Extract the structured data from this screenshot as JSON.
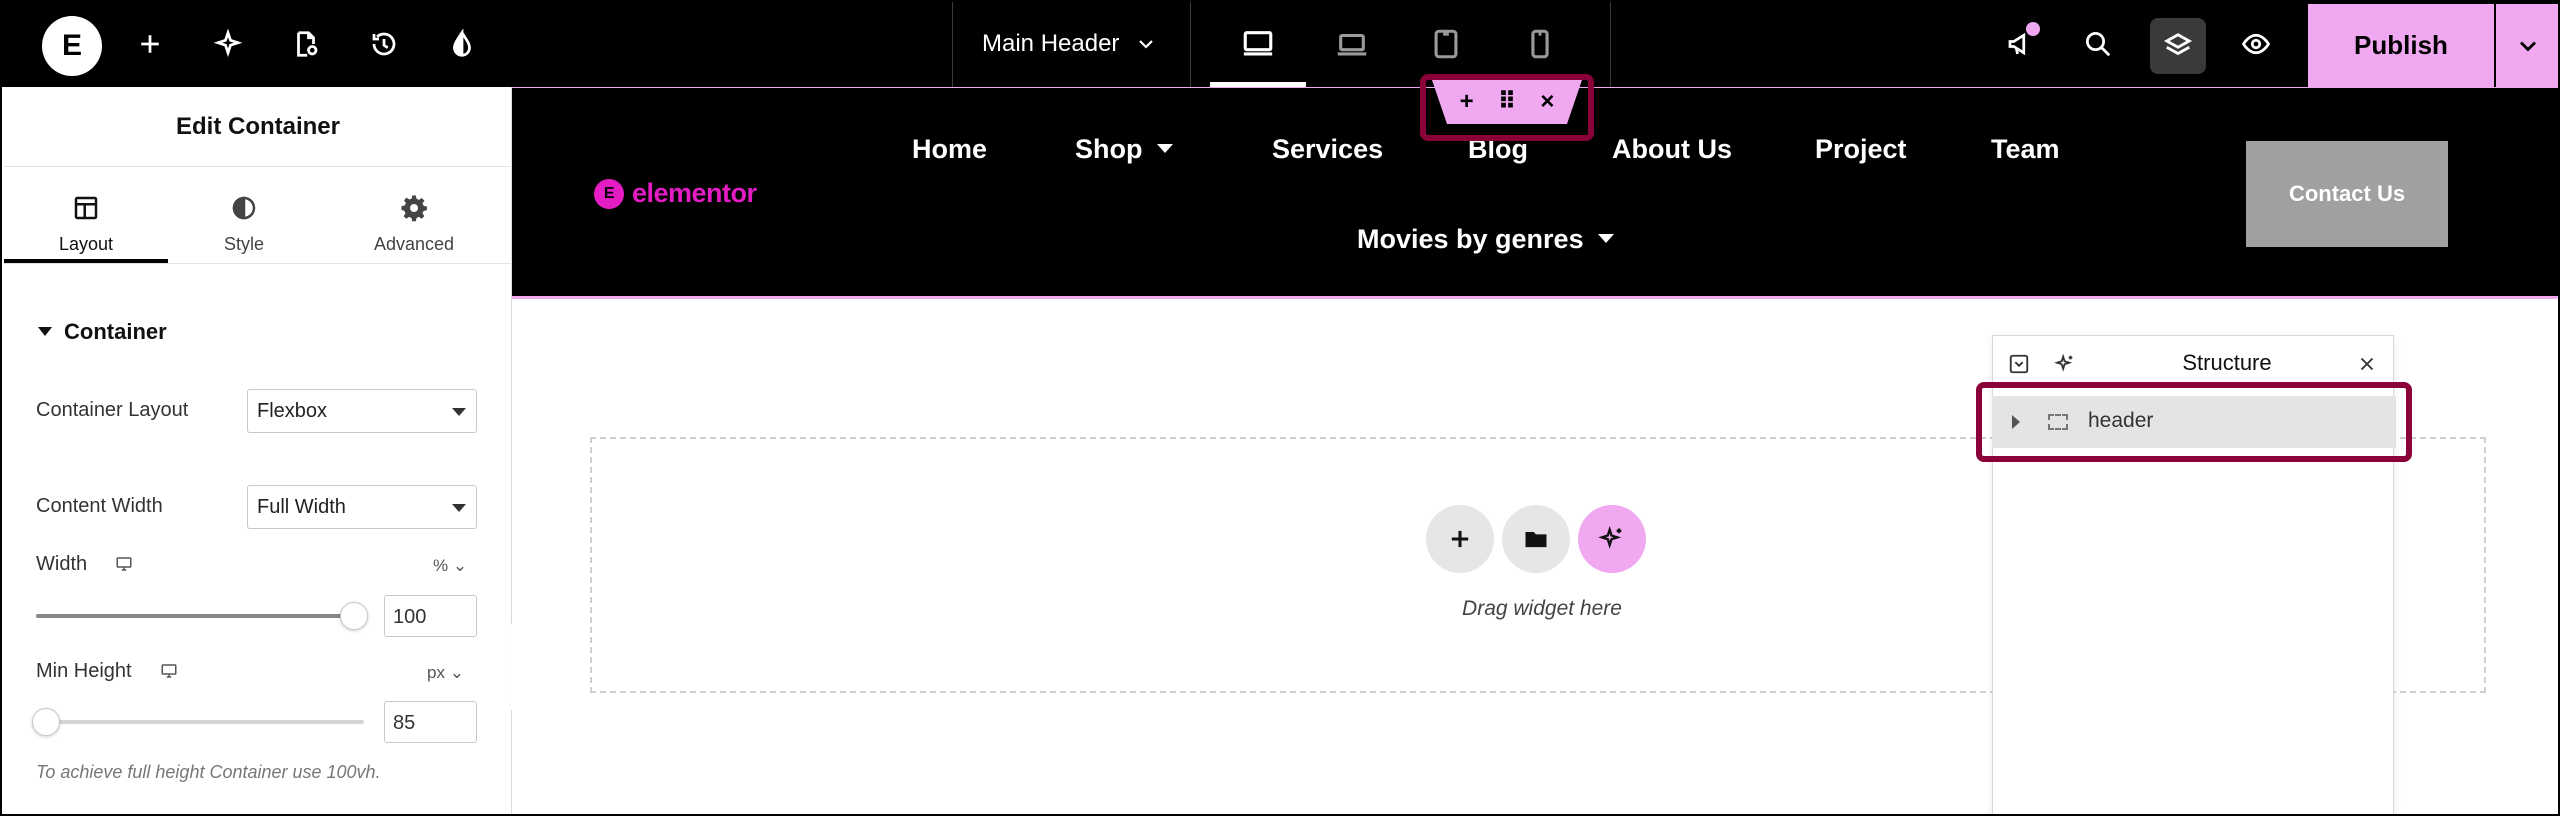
{
  "topbar": {
    "logo": "E",
    "document_title": "Main Header",
    "publish_label": "Publish",
    "colors": {
      "accent": "#f0a8f0",
      "highlight": "#8a0038"
    }
  },
  "panel": {
    "title": "Edit Container",
    "tabs": [
      {
        "label": "Layout",
        "icon": "layout-icon"
      },
      {
        "label": "Style",
        "icon": "style-icon"
      },
      {
        "label": "Advanced",
        "icon": "gear-icon"
      }
    ],
    "section_title": "Container",
    "container_layout": {
      "label": "Container Layout",
      "value": "Flexbox"
    },
    "content_width": {
      "label": "Content Width",
      "value": "Full Width"
    },
    "width": {
      "label": "Width",
      "unit": "%",
      "value": "100",
      "slider_fraction": 1.0
    },
    "min_height": {
      "label": "Min Height",
      "unit": "px",
      "value": "85",
      "slider_fraction": 0.0
    },
    "hint": "To achieve full height Container use 100vh."
  },
  "site": {
    "logo_text": "elementor",
    "nav": [
      {
        "label": "Home",
        "dropdown": false
      },
      {
        "label": "Shop",
        "dropdown": true
      },
      {
        "label": "Services",
        "dropdown": false
      },
      {
        "label": "Blog",
        "dropdown": false
      },
      {
        "label": "About Us",
        "dropdown": false
      },
      {
        "label": "Project",
        "dropdown": false
      },
      {
        "label": "Team",
        "dropdown": false
      },
      {
        "label": "Movies by genres",
        "dropdown": true
      }
    ],
    "contact_label": "Contact Us",
    "handle": {
      "add": "+",
      "move": "⠿",
      "close": "×"
    }
  },
  "canvas": {
    "drag_text": "Drag widget here"
  },
  "structure": {
    "title": "Structure",
    "items": [
      {
        "label": "header"
      }
    ]
  }
}
